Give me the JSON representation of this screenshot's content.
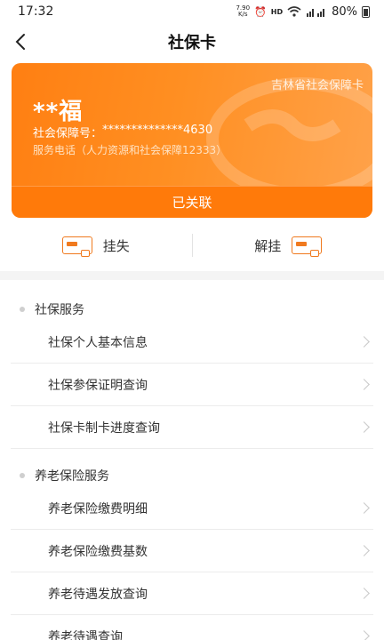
{
  "status_bar": {
    "time": "17:32",
    "net_speed_top": "7.90",
    "net_speed_bottom": "K/s",
    "hd": "HD",
    "battery": "80%"
  },
  "nav": {
    "title": "社保卡"
  },
  "card": {
    "issuer": "吉林省社会保障卡",
    "holder_name": "**福",
    "number_label": "社会保障号：",
    "number_value": "**************4630",
    "service_phone": "服务电话（人力资源和社会保障12333）",
    "status": "已关联",
    "gradient_start": "#ff7f12",
    "gradient_end": "#ffa24a"
  },
  "actions": {
    "report_loss": "挂失",
    "unlock": "解挂",
    "accent_color": "#f07a1f"
  },
  "sections": [
    {
      "title": "社保服务",
      "items": [
        "社保个人基本信息",
        "社保参保证明查询",
        "社保卡制卡进度查询"
      ]
    },
    {
      "title": "养老保险服务",
      "items": [
        "养老保险缴费明细",
        "养老保险缴费基数",
        "养老待遇发放查询",
        "养老待遇查询"
      ]
    }
  ]
}
